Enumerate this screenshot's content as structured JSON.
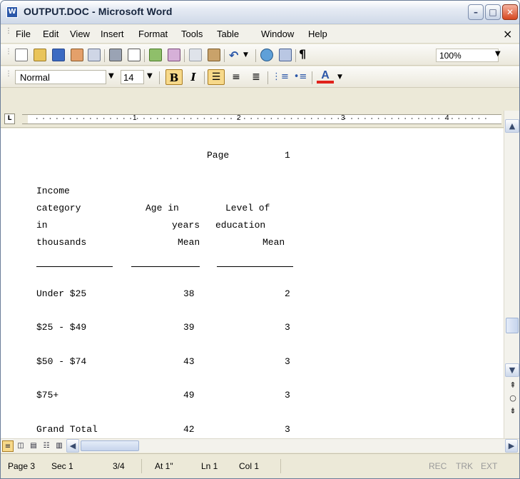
{
  "window": {
    "title": "OUTPUT.DOC - Microsoft Word",
    "app_icon": "W"
  },
  "menu": [
    "File",
    "Edit",
    "View",
    "Insert",
    "Format",
    "Tools",
    "Table",
    "Window",
    "Help"
  ],
  "menu_close": "×",
  "toolbar_standard": {
    "zoom": "100%",
    "pilcrow": "¶"
  },
  "toolbar_formatting": {
    "style": "Normal",
    "font_size": "14",
    "bold": "B",
    "italic": "I",
    "font_color": "A"
  },
  "ruler": {
    "numbers": [
      "1",
      "2",
      "3",
      "4"
    ],
    "tab_marker": "L"
  },
  "document": {
    "page_label": "Page",
    "page_number": "1",
    "headers": [
      [
        "Income",
        "",
        ""
      ],
      [
        "category",
        "Age in",
        "Level of"
      ],
      [
        "in",
        "years",
        "education"
      ],
      [
        "thousands",
        "Mean",
        "Mean"
      ]
    ],
    "rows": [
      {
        "category": "Under $25",
        "age": "38",
        "education": "2"
      },
      {
        "category": "$25 - $49",
        "age": "39",
        "education": "3"
      },
      {
        "category": "$50 - $74",
        "age": "43",
        "education": "3"
      },
      {
        "category": "$75+",
        "age": "49",
        "education": "3"
      },
      {
        "category": "Grand Total",
        "age": "42",
        "education": "3"
      }
    ]
  },
  "status": {
    "page": "Page 3",
    "sec": "Sec 1",
    "pages": "3/4",
    "at": "At 1\"",
    "ln": "Ln 1",
    "col": "Col 1",
    "rec": "REC",
    "trk": "TRK",
    "ext": "EXT"
  }
}
